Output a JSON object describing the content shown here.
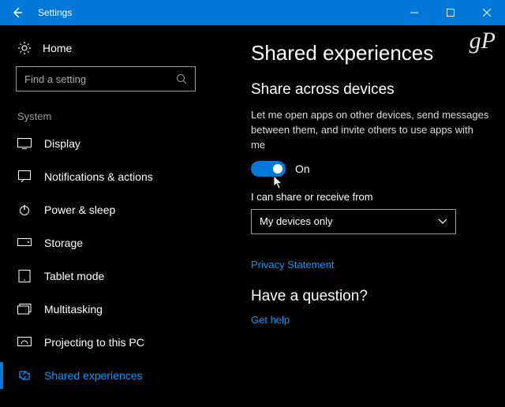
{
  "titlebar": {
    "title": "Settings"
  },
  "sidebar": {
    "home": "Home",
    "search_placeholder": "Find a setting",
    "group": "System",
    "items": [
      {
        "label": "Display"
      },
      {
        "label": "Notifications & actions"
      },
      {
        "label": "Power & sleep"
      },
      {
        "label": "Storage"
      },
      {
        "label": "Tablet mode"
      },
      {
        "label": "Multitasking"
      },
      {
        "label": "Projecting to this PC"
      },
      {
        "label": "Shared experiences"
      }
    ]
  },
  "main": {
    "heading": "Shared experiences",
    "section1_title": "Share across devices",
    "section1_desc": "Let me open apps on other devices, send messages between them, and invite others to use apps with me",
    "toggle_state": "On",
    "share_label": "I can share or receive from",
    "dropdown_value": "My devices only",
    "privacy_link": "Privacy Statement",
    "question_heading": "Have a question?",
    "help_link": "Get help"
  },
  "watermark": "gP"
}
